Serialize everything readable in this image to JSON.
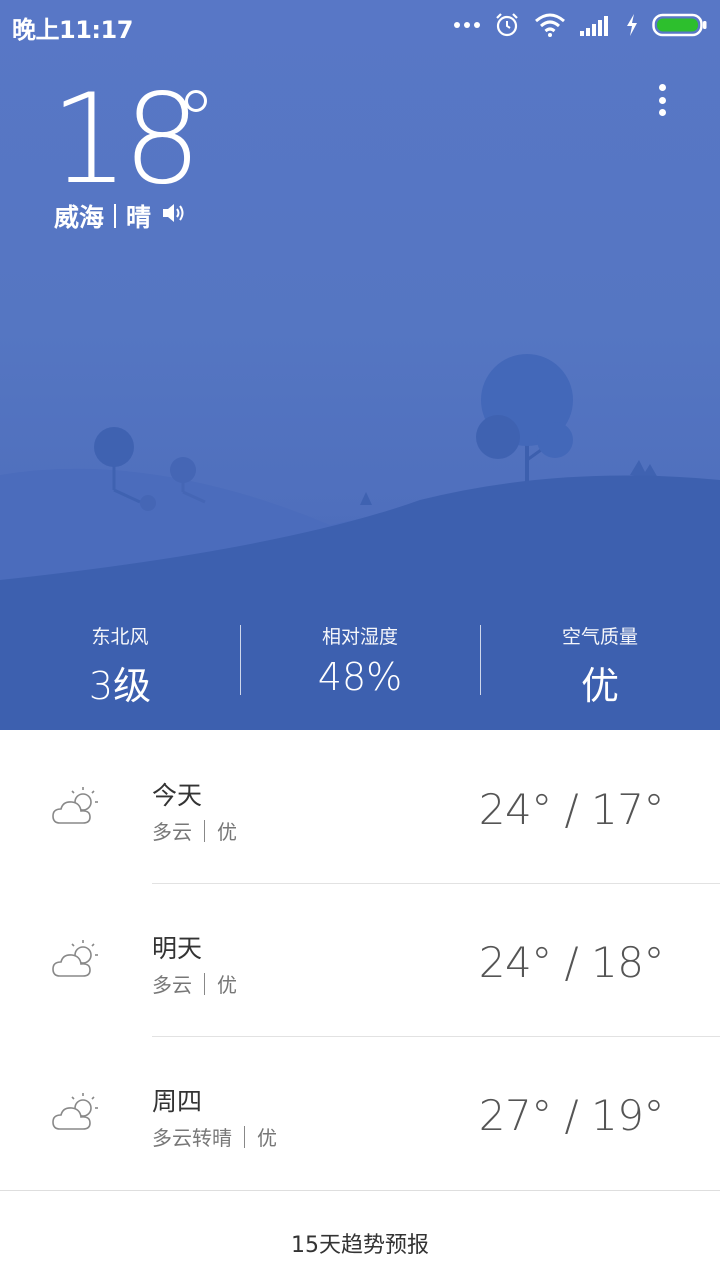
{
  "statusbar": {
    "time": "晚上11:17",
    "icons": [
      "more-dots-icon",
      "alarm-icon",
      "wifi-icon",
      "signal-icon",
      "charging-icon",
      "battery-icon"
    ],
    "battery_color": "#2dbf2d"
  },
  "current": {
    "temperature": "18",
    "city": "威海",
    "condition": "晴"
  },
  "stats": [
    {
      "label": "东北风",
      "value": "3级"
    },
    {
      "label": "相对湿度",
      "value": "48%"
    },
    {
      "label": "空气质量",
      "value": "优"
    }
  ],
  "forecast": [
    {
      "day": "今天",
      "condition": "多云",
      "aqi": "优",
      "temp": "24° / 17°",
      "icon": "partly-cloudy-icon"
    },
    {
      "day": "明天",
      "condition": "多云",
      "aqi": "优",
      "temp": "24° / 18°",
      "icon": "partly-cloudy-icon"
    },
    {
      "day": "周四",
      "condition": "多云转晴",
      "aqi": "优",
      "temp": "27° / 19°",
      "icon": "partly-cloudy-icon"
    }
  ],
  "bottom": {
    "label": "15天趋势预报"
  },
  "colors": {
    "hero_top": "#5877c6",
    "hero_bottom": "#3f62b1"
  }
}
